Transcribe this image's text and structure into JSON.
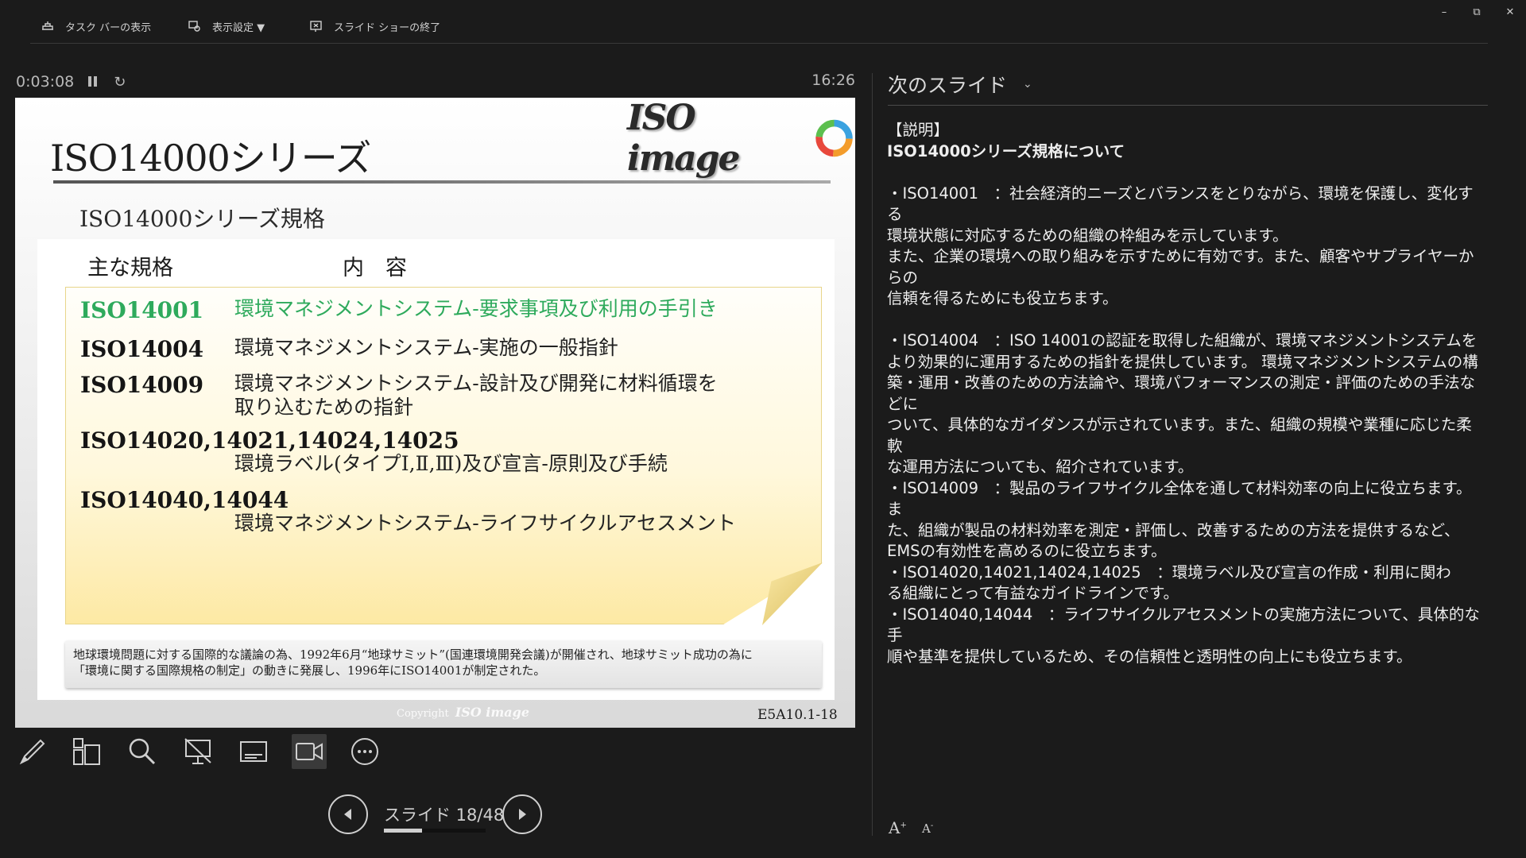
{
  "toolbar": {
    "taskbar_label": "タスク バーの表示",
    "display_settings_label": "表示設定 ▼",
    "end_show_label": "スライド ショーの終了"
  },
  "window": {
    "minimize": "–",
    "restore": "⧉",
    "close": "✕"
  },
  "timer": {
    "elapsed": "0:03:08",
    "clock": "16:26"
  },
  "slide": {
    "title": "ISO14000シリーズ",
    "logo_text": "ISO image",
    "subtitle": "ISO14000シリーズ規格",
    "col_head_1": "主な規格",
    "col_head_2": "内　容",
    "standards": [
      {
        "code": "ISO14001",
        "desc": "環境マネジメントシステム-要求事項及び利用の手引き"
      },
      {
        "code": "ISO14004",
        "desc": "環境マネジメントシステム-実施の一般指針"
      },
      {
        "code": "ISO14009",
        "desc_1": "環境マネジメントシステム-設計及び開発に材料循環を",
        "desc_2": "取り込むための指針"
      },
      {
        "code": "ISO14020,14021,14024,14025",
        "desc": "環境ラベル(タイプⅠ,Ⅱ,Ⅲ)及び宣言-原則及び手続"
      },
      {
        "code": "ISO14040,14044",
        "desc": "環境マネジメントシステム-ライフサイクルアセスメント"
      }
    ],
    "footnote_1": "地球環境問題に対する国際的な議論の為、1992年6月“地球サミット”(国連環境開発会議)が開催され、地球サミット成功の為に",
    "footnote_2": "「環境に関する国際規格の制定」の動きに発展し、1996年にISO14001が制定された。",
    "copyright": "Copyright",
    "copyright_brand": "ISO image",
    "code": "E5A10.1-18"
  },
  "navigation": {
    "counter": "スライド 18/48",
    "progress": 0.375
  },
  "next_slide": {
    "heading": "次のスライド",
    "notes": [
      "【説明】",
      "ISO14000シリーズ規格について",
      "・ISO14001　：社会経済的ニーズとバランスをとりながら、環境を保護し、変化する",
      "環境状態に対応するための組織の枠組みを示しています。",
      "また、企業の環境への取り組みを示すために有効です。また、顧客やサプライヤーからの",
      "信頼を得るためにも役立ちます。",
      "・ISO14004　：ISO 14001の認証を取得した組織が、環境マネジメントシステムを",
      "より効果的に運用するための指針を提供しています。 環境マネジメントシステムの構",
      "築・運用・改善のための方法論や、環境パフォーマンスの測定・評価のための手法などに",
      "ついて、具体的なガイダンスが示されています。また、組織の規模や業種に応じた柔軟",
      "な運用方法についても、紹介されています。",
      "・ISO14009　：製品のライフサイクル全体を通して材料効率の向上に役立ちます。ま",
      "た、組織が製品の材料効率を測定・評価し、改善するための方法を提供するなど、",
      "EMSの有効性を高めるのに役立ちます。",
      "・ISO14020,14021,14024,14025　：環境ラベル及び宣言の作成・利用に関わ",
      "る組織にとって有益なガイドラインです。",
      "・ISO14040,14044　：ライフサイクルアセスメントの実施方法について、具体的な手",
      "順や基準を提供しているため、その信頼性と透明性の向上にも役立ちます。"
    ],
    "font_up": "A",
    "font_down": "A"
  },
  "colors": {
    "highlight": "#2eaa5c",
    "background": "#1b1b1b"
  }
}
